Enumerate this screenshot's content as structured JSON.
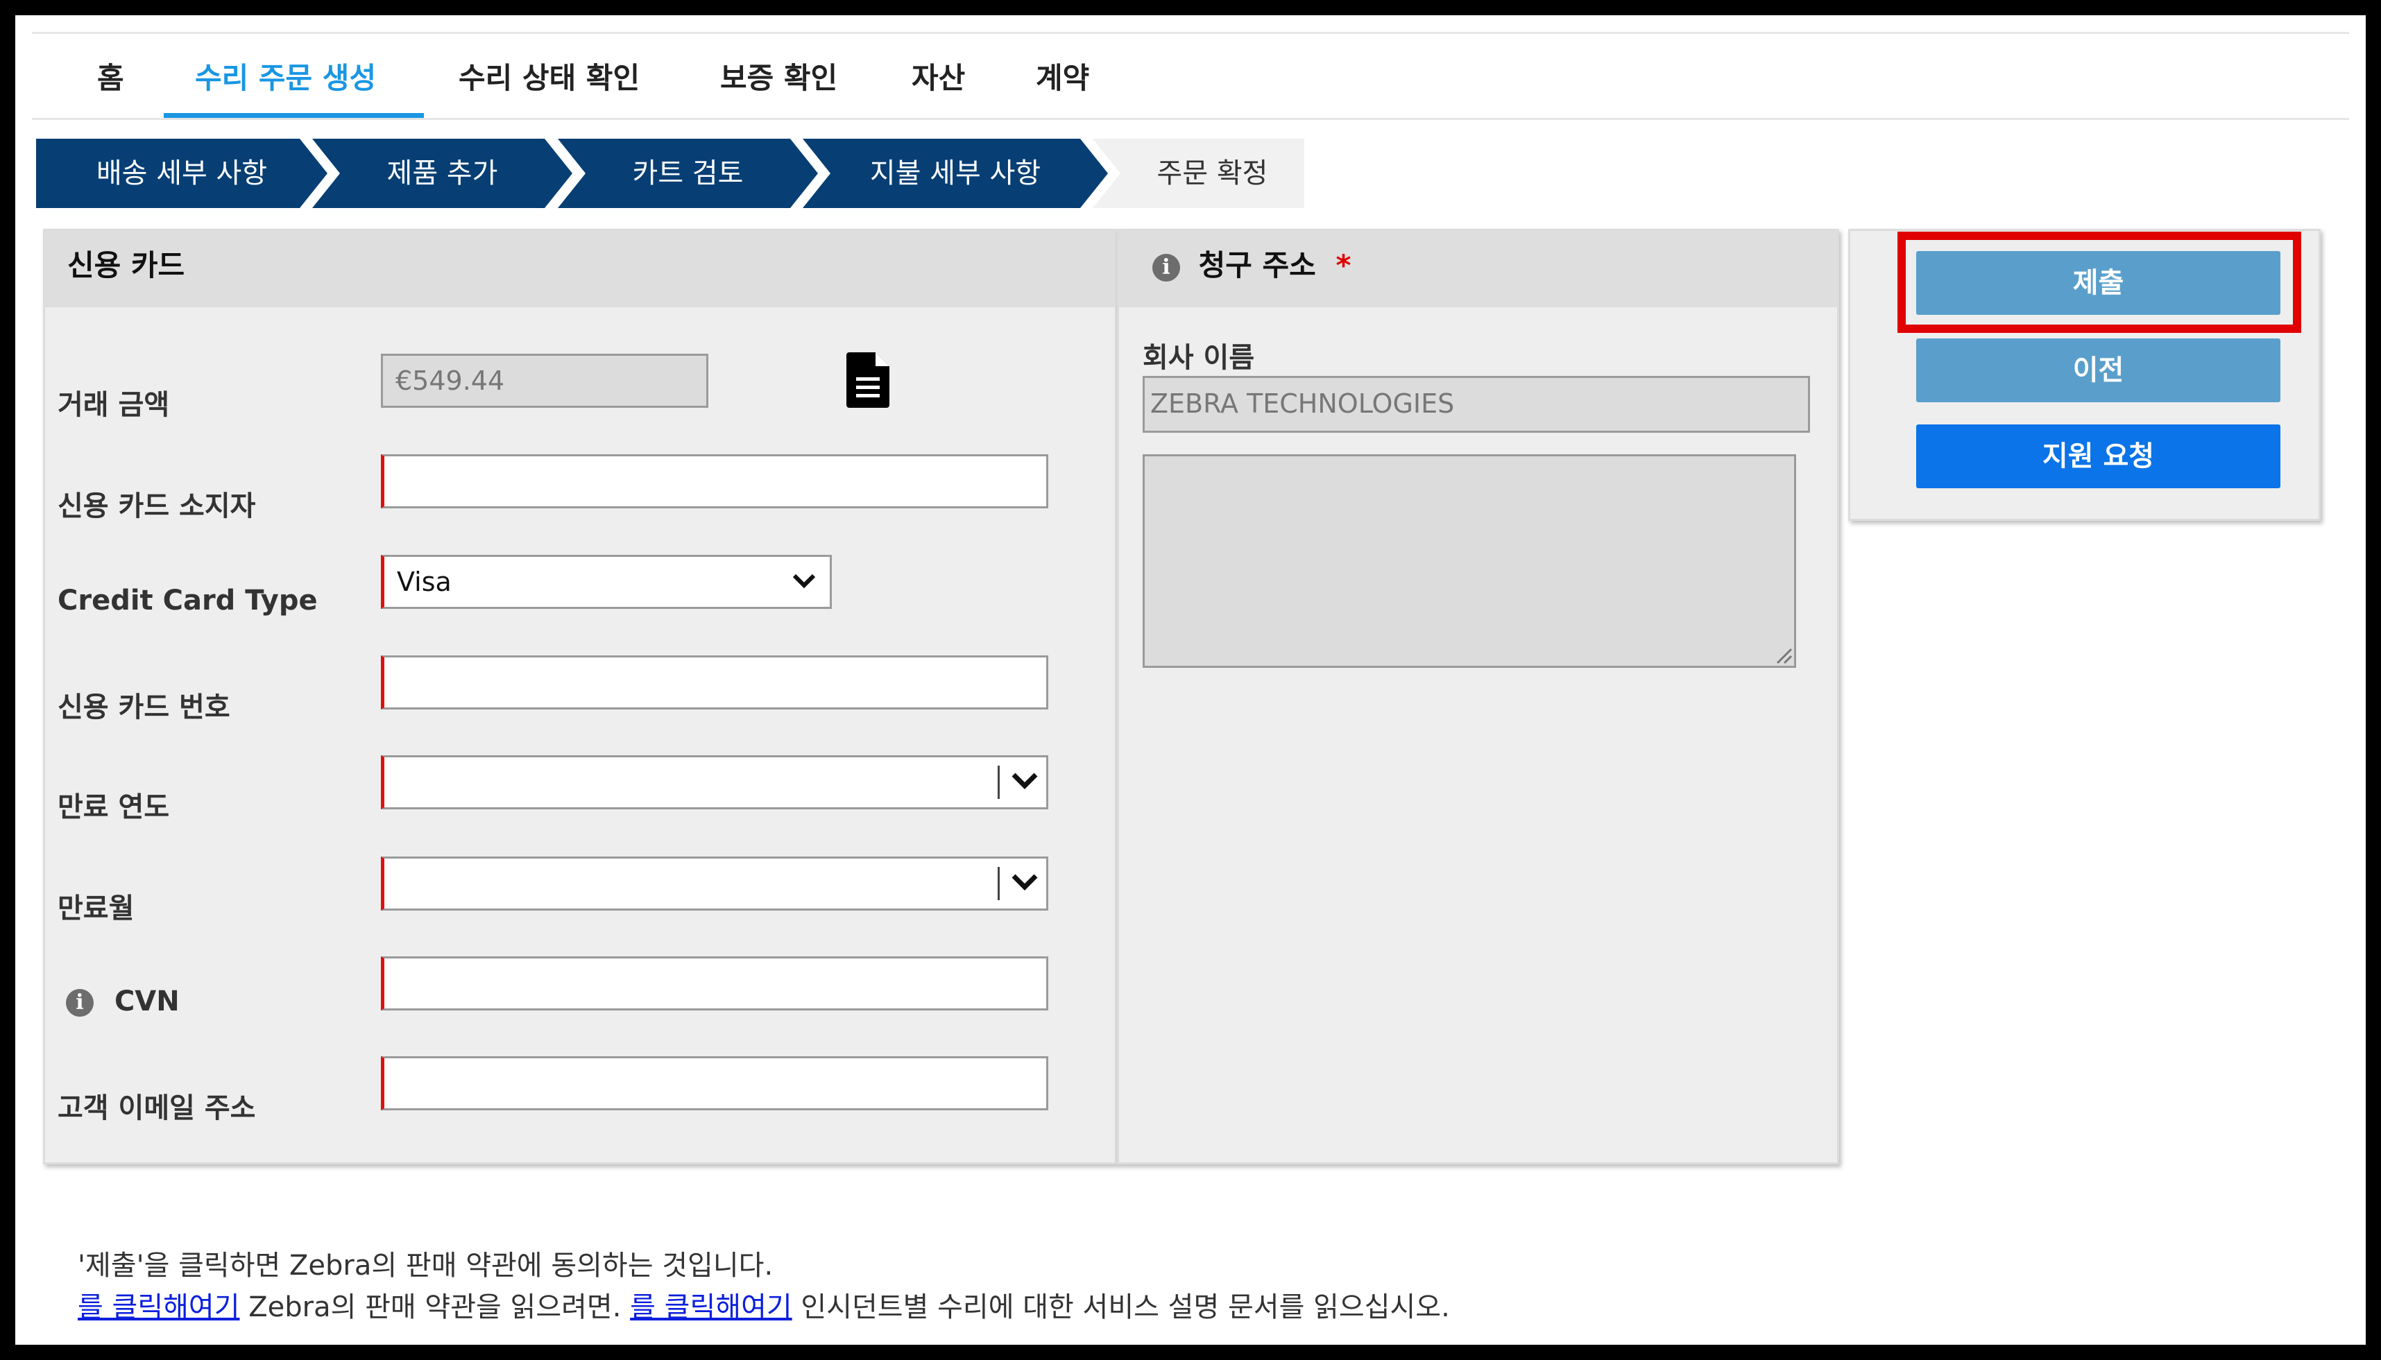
{
  "nav": {
    "tabs": [
      {
        "label": "홈"
      },
      {
        "label": "수리 주문 생성",
        "active": true
      },
      {
        "label": "수리 상태 확인"
      },
      {
        "label": "보증 확인"
      },
      {
        "label": "자산"
      },
      {
        "label": "계약"
      }
    ]
  },
  "steps": [
    {
      "label": "배송 세부 사항",
      "status": "done"
    },
    {
      "label": "제품 추가",
      "status": "done"
    },
    {
      "label": "카트 검토",
      "status": "done"
    },
    {
      "label": "지불 세부 사항",
      "status": "current"
    },
    {
      "label": "주문 확정",
      "status": "pending"
    }
  ],
  "credit_card": {
    "title": "신용 카드",
    "fields": {
      "amount": {
        "label": "거래 금액",
        "value": "€549.44"
      },
      "holder": {
        "label": "신용 카드 소지자",
        "value": ""
      },
      "card_type": {
        "label": "Credit Card Type",
        "value": "Visa"
      },
      "card_number": {
        "label": "신용 카드 번호",
        "value": ""
      },
      "exp_year": {
        "label": "만료 연도",
        "value": ""
      },
      "exp_month": {
        "label": "만료월",
        "value": ""
      },
      "cvn": {
        "label": "CVN",
        "value": ""
      },
      "email": {
        "label": "고객 이메일 주소",
        "value": ""
      }
    },
    "document_icon": "document-icon"
  },
  "billing": {
    "title": "청구 주소",
    "required_mark": "*",
    "company_label": "회사 이름",
    "company_value": "ZEBRA TECHNOLOGIES",
    "address_value": ""
  },
  "actions": {
    "submit": "제출",
    "previous": "이전",
    "support": "지원 요청"
  },
  "colors": {
    "accent_blue": "#1a96e3",
    "step_blue": "#073f74",
    "button_light": "#5a9fcb",
    "button_support": "#0a74e8",
    "highlight_red": "#e00000"
  },
  "footer": {
    "line1": "'제출'을 클릭하면 Zebra의 판매 약관에 동의하는 것입니다.",
    "link1": "를 클릭해여기",
    "text1": " Zebra의 판매 약관을 읽으려면. ",
    "link2": "를 클릭해여기",
    "text2": " 인시던트별 수리에 대한 서비스 설명 문서를 읽으십시오."
  }
}
